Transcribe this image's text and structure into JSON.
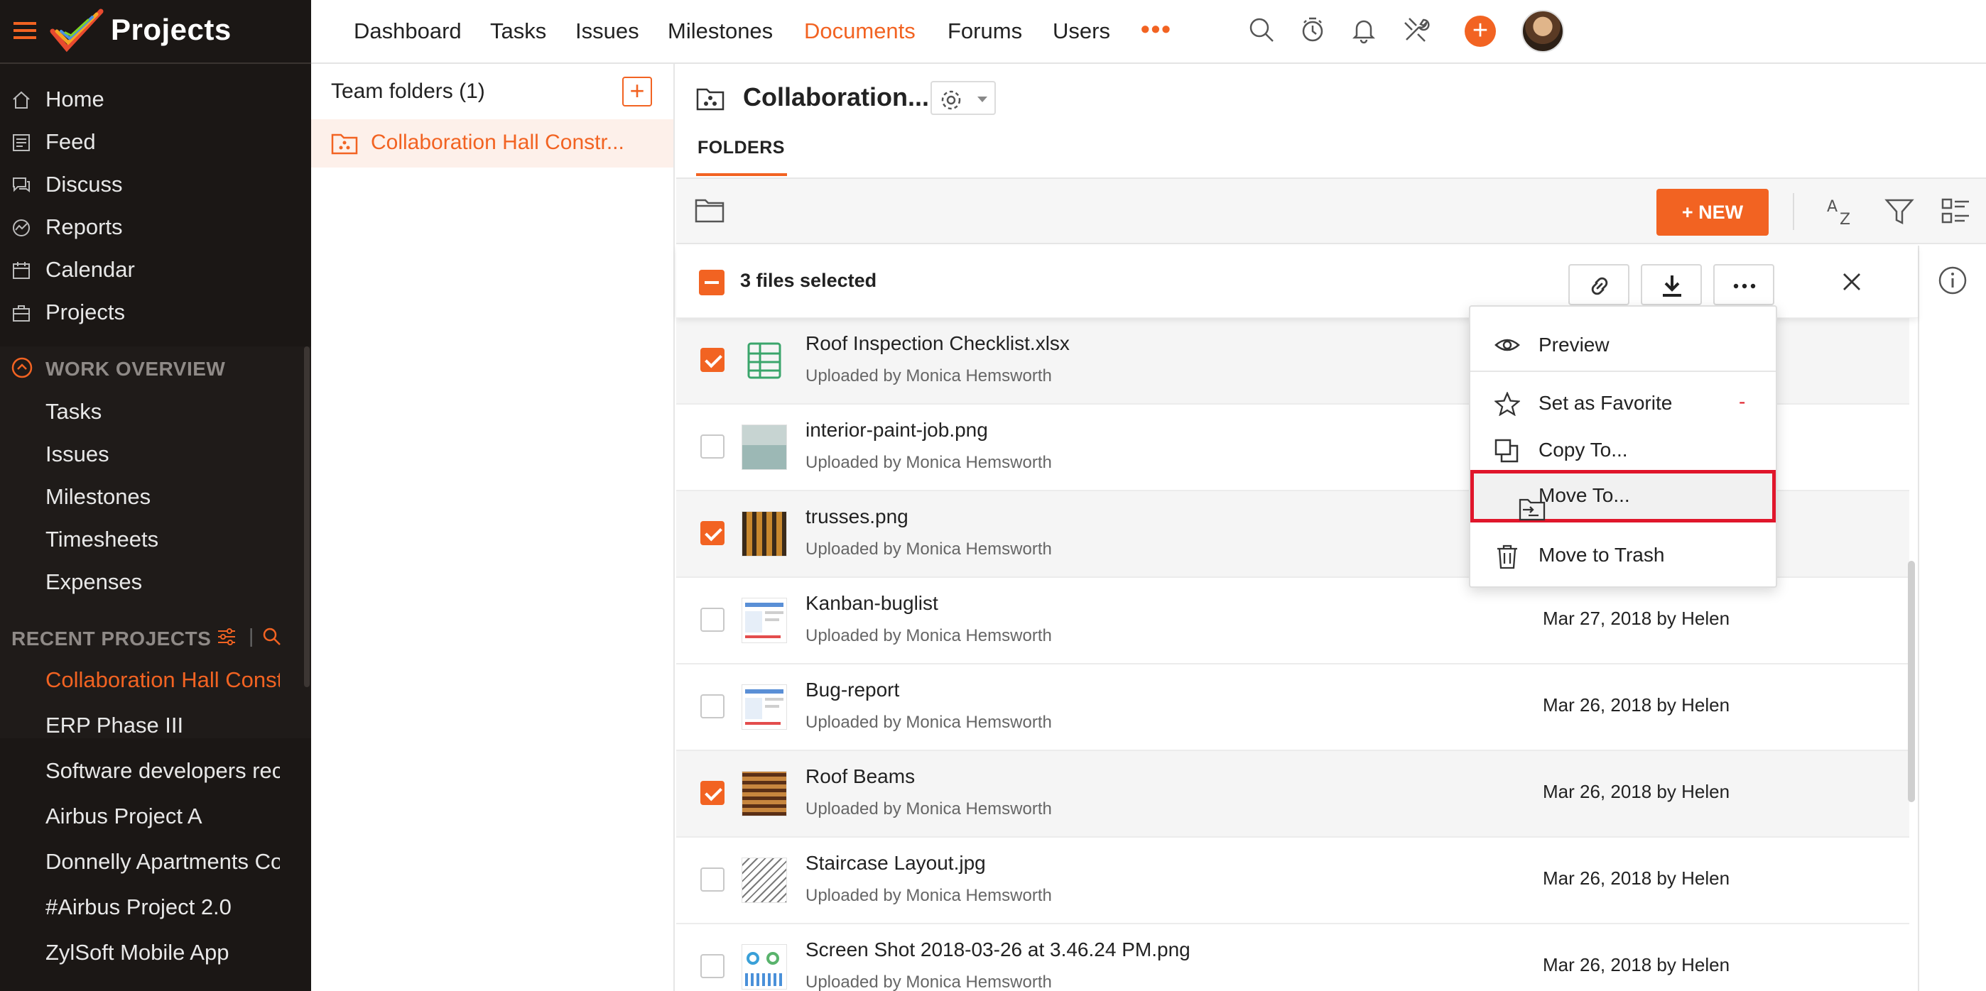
{
  "app": {
    "title": "Projects"
  },
  "sidebar": {
    "nav": [
      "Home",
      "Feed",
      "Discuss",
      "Reports",
      "Calendar",
      "Projects"
    ],
    "work_overview": {
      "title": "WORK OVERVIEW",
      "items": [
        "Tasks",
        "Issues",
        "Milestones",
        "Timesheets",
        "Expenses"
      ]
    },
    "recent_projects": {
      "title": "RECENT PROJECTS",
      "separator": "|",
      "items": [
        "Collaboration Hall Construction",
        "ERP Phase III",
        "Software developers recruitment",
        "Airbus Project A",
        "Donnelly Apartments Construction",
        "#Airbus Project 2.0",
        "ZylSoft Mobile App"
      ]
    }
  },
  "topnav": {
    "tabs": [
      "Dashboard",
      "Tasks",
      "Issues",
      "Milestones",
      "Documents",
      "Forums",
      "Users"
    ],
    "active_tab": "Documents",
    "more": "•••",
    "add": "+"
  },
  "folders_panel": {
    "title": "Team folders (1)",
    "add": "+",
    "item": "Collaboration Hall Constr..."
  },
  "main": {
    "project_title": "Collaboration...",
    "tab": "FOLDERS",
    "new_button": "+ NEW",
    "selection": {
      "text": "3 files selected"
    }
  },
  "files": [
    {
      "name": "Roof Inspection Checklist.xlsx",
      "uploader": "Uploaded by Monica Hemsworth",
      "date": "",
      "selected": true,
      "thumb": "xlsx"
    },
    {
      "name": "interior-paint-job.png",
      "uploader": "Uploaded by Monica Hemsworth",
      "date": "",
      "selected": false,
      "thumb": "paint"
    },
    {
      "name": "trusses.png",
      "uploader": "Uploaded by Monica Hemsworth",
      "date": "",
      "selected": true,
      "thumb": "truss"
    },
    {
      "name": "Kanban-buglist",
      "uploader": "Uploaded by Monica Hemsworth",
      "date": "Mar 27, 2018 by Helen",
      "selected": false,
      "thumb": "doc"
    },
    {
      "name": "Bug-report",
      "uploader": "Uploaded by Monica Hemsworth",
      "date": "Mar 26, 2018 by Helen",
      "selected": false,
      "thumb": "doc"
    },
    {
      "name": "Roof Beams",
      "uploader": "Uploaded by Monica Hemsworth",
      "date": "Mar 26, 2018 by Helen",
      "selected": true,
      "thumb": "beams"
    },
    {
      "name": "Staircase Layout.jpg",
      "uploader": "Uploaded by Monica Hemsworth",
      "date": "Mar 26, 2018 by Helen",
      "selected": false,
      "thumb": "stair"
    },
    {
      "name": "Screen Shot 2018-03-26 at 3.46.24 PM.png",
      "uploader": "Uploaded by Monica Hemsworth",
      "date": "Mar 26, 2018 by Helen",
      "selected": false,
      "thumb": "shot"
    }
  ],
  "context_menu": {
    "preview": "Preview",
    "favorite": "Set as Favorite",
    "favorite_marker": "-",
    "copy": "Copy To...",
    "move": "Move To...",
    "trash": "Move to Trash",
    "highlighted": "Move To..."
  },
  "colors": {
    "accent": "#f26322",
    "sidebar_bg": "#1b1715",
    "highlight": "#e0162b"
  }
}
